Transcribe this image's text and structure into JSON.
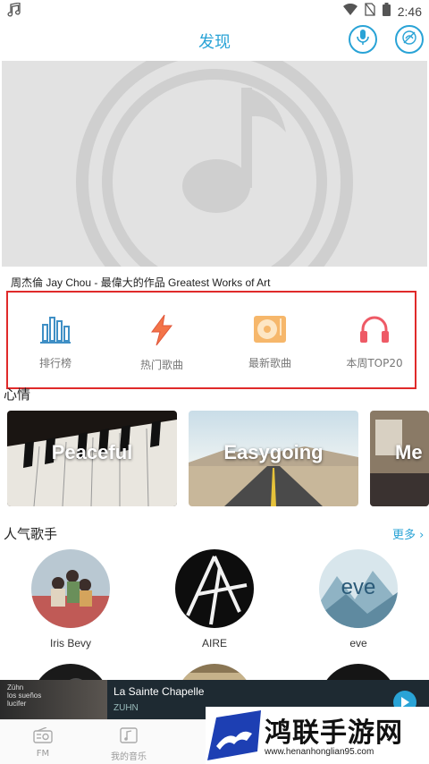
{
  "status_bar": {
    "time": "2:46"
  },
  "header": {
    "title": "发现"
  },
  "banner": {
    "caption": "周杰倫 Jay Chou - 最偉大的作品 Greatest Works of Art"
  },
  "quick_links": [
    {
      "label": "排行榜",
      "icon": "bar-chart-icon"
    },
    {
      "label": "热门歌曲",
      "icon": "flash-icon"
    },
    {
      "label": "最新歌曲",
      "icon": "record-player-icon"
    },
    {
      "label": "本周TOP20",
      "icon": "headphones-icon"
    }
  ],
  "mood": {
    "title": "心情",
    "cards": [
      {
        "label": "Peaceful"
      },
      {
        "label": "Easygoing"
      },
      {
        "label": "Me"
      }
    ]
  },
  "artists": {
    "title": "人气歌手",
    "more": "更多",
    "items": [
      {
        "name": "Iris Bevy"
      },
      {
        "name": "AIRE"
      },
      {
        "name": "eve"
      }
    ]
  },
  "player": {
    "thumb_text": "Zühn\nlos sueños\nlucifer",
    "song": "La Sainte Chapelle",
    "artist": "ZUHN"
  },
  "bottom_nav": [
    {
      "label": "FM",
      "icon": "radio-icon"
    },
    {
      "label": "我的音乐",
      "icon": "music-note-icon"
    }
  ],
  "watermark": {
    "brand": "鸿联手游网",
    "url": "www.henanhonglian95.com"
  },
  "colors": {
    "accent": "#29a3d6",
    "highlight_box": "#e02a2a",
    "player_bg": "#1e2a32"
  }
}
